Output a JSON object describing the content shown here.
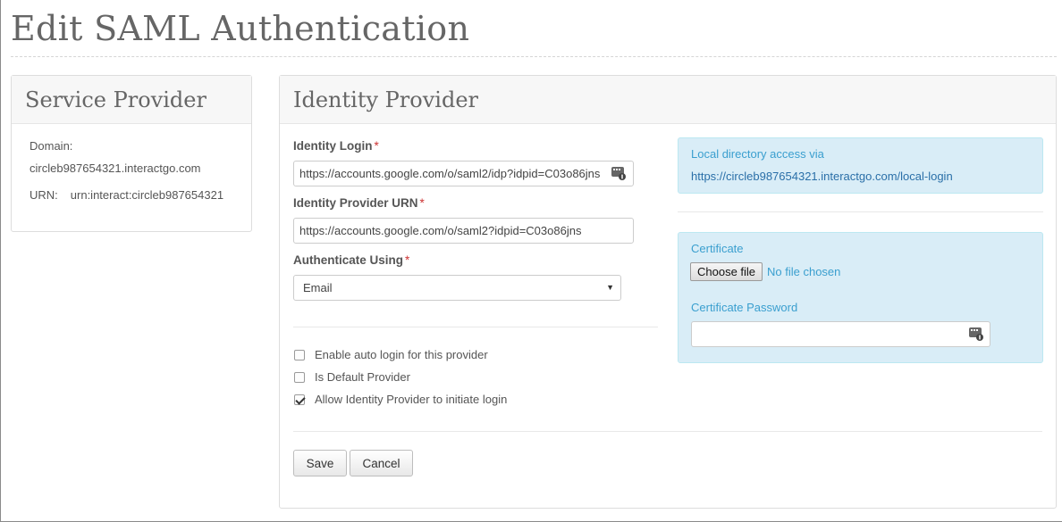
{
  "page": {
    "title": "Edit SAML Authentication"
  },
  "service_provider": {
    "heading": "Service Provider",
    "domain_label": "Domain:",
    "domain_value": "circleb987654321.interactgo.com",
    "urn_label": "URN:",
    "urn_value": "urn:interact:circleb987654321"
  },
  "identity_provider": {
    "heading": "Identity Provider",
    "login_label": "Identity Login",
    "login_value": "https://accounts.google.com/o/saml2/idp?idpid=C03o86jns",
    "urn_label": "Identity Provider URN",
    "urn_value": "https://accounts.google.com/o/saml2?idpid=C03o86jns",
    "authenticate_label": "Authenticate Using",
    "authenticate_selected": "Email",
    "required_marker": "*",
    "options": {
      "auto_login": {
        "label": "Enable auto login for this provider",
        "checked": false
      },
      "default_provider": {
        "label": "Is Default Provider",
        "checked": false
      },
      "idp_initiated": {
        "label": "Allow Identity Provider to initiate login",
        "checked": true
      }
    },
    "save_label": "Save",
    "cancel_label": "Cancel"
  },
  "local_directory": {
    "label": "Local directory access via",
    "link": "https://circleb987654321.interactgo.com/local-login"
  },
  "certificate": {
    "label": "Certificate",
    "choose_file_label": "Choose file",
    "no_file_text": "No file chosen",
    "password_label": "Certificate Password",
    "password_value": ""
  },
  "icons": {
    "key_icon": "password-manager-key-icon",
    "caret": "chevron-down-icon"
  },
  "colors": {
    "info_bg": "#d9edf7",
    "info_text": "#3a9fcf",
    "link": "#2a6fa8",
    "required": "#cc3333"
  }
}
